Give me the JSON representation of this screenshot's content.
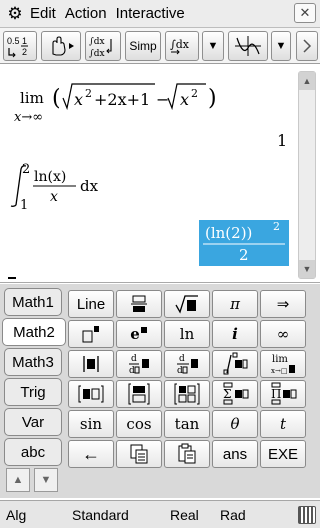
{
  "menubar": {
    "gear_icon": "⚙",
    "menus": [
      "Edit",
      "Action",
      "Interactive"
    ],
    "close_glyph": "✕"
  },
  "toolbar": {
    "fraction_decimal_button": "0.5↔½",
    "simp_label": "Simp",
    "intdx_label": "∫dx",
    "dropdown_glyph": "▼"
  },
  "work": {
    "limit": {
      "lim": "lim",
      "sub": "x→∞",
      "open_paren": "(",
      "sqrt1_body": "x",
      "sq1": "2",
      "sqrt1_rest": "+2x+1",
      "minus": "−",
      "sqrt2_body": "x",
      "sq2": "2",
      "close_paren": ")"
    },
    "limit_result": "1",
    "integral": {
      "upper": "2",
      "lower": "1",
      "numerator": "ln(x)",
      "denominator": "x",
      "dx": "dx"
    },
    "integral_result": {
      "numerator": "(ln(2))",
      "exp": "2",
      "denominator": "2"
    },
    "scroll_up": "▲",
    "scroll_down": "▼"
  },
  "keyboard": {
    "tabs": [
      "Math1",
      "Math2",
      "Math3",
      "Trig",
      "Var",
      "abc"
    ],
    "active_tab": "Math2",
    "nav_up": "▲",
    "nav_down": "▼",
    "keys": {
      "line": "Line",
      "lim": "lim",
      "lim_sub": "x→□",
      "sin": "sin",
      "cos": "cos",
      "tan": "tan",
      "theta": "θ",
      "t": "t",
      "arrow": "⇒",
      "infinity": "∞",
      "e": "e",
      "ln": "ln",
      "i": "i",
      "pi": "π",
      "sqrt": "√",
      "d": "d",
      "ans": "ans",
      "exe": "EXE",
      "back_arrow": "←"
    }
  },
  "status": {
    "mode": "Alg",
    "display": "Standard",
    "number": "Real",
    "angle": "Rad"
  },
  "colors": {
    "highlight": "#3aa6e0"
  }
}
